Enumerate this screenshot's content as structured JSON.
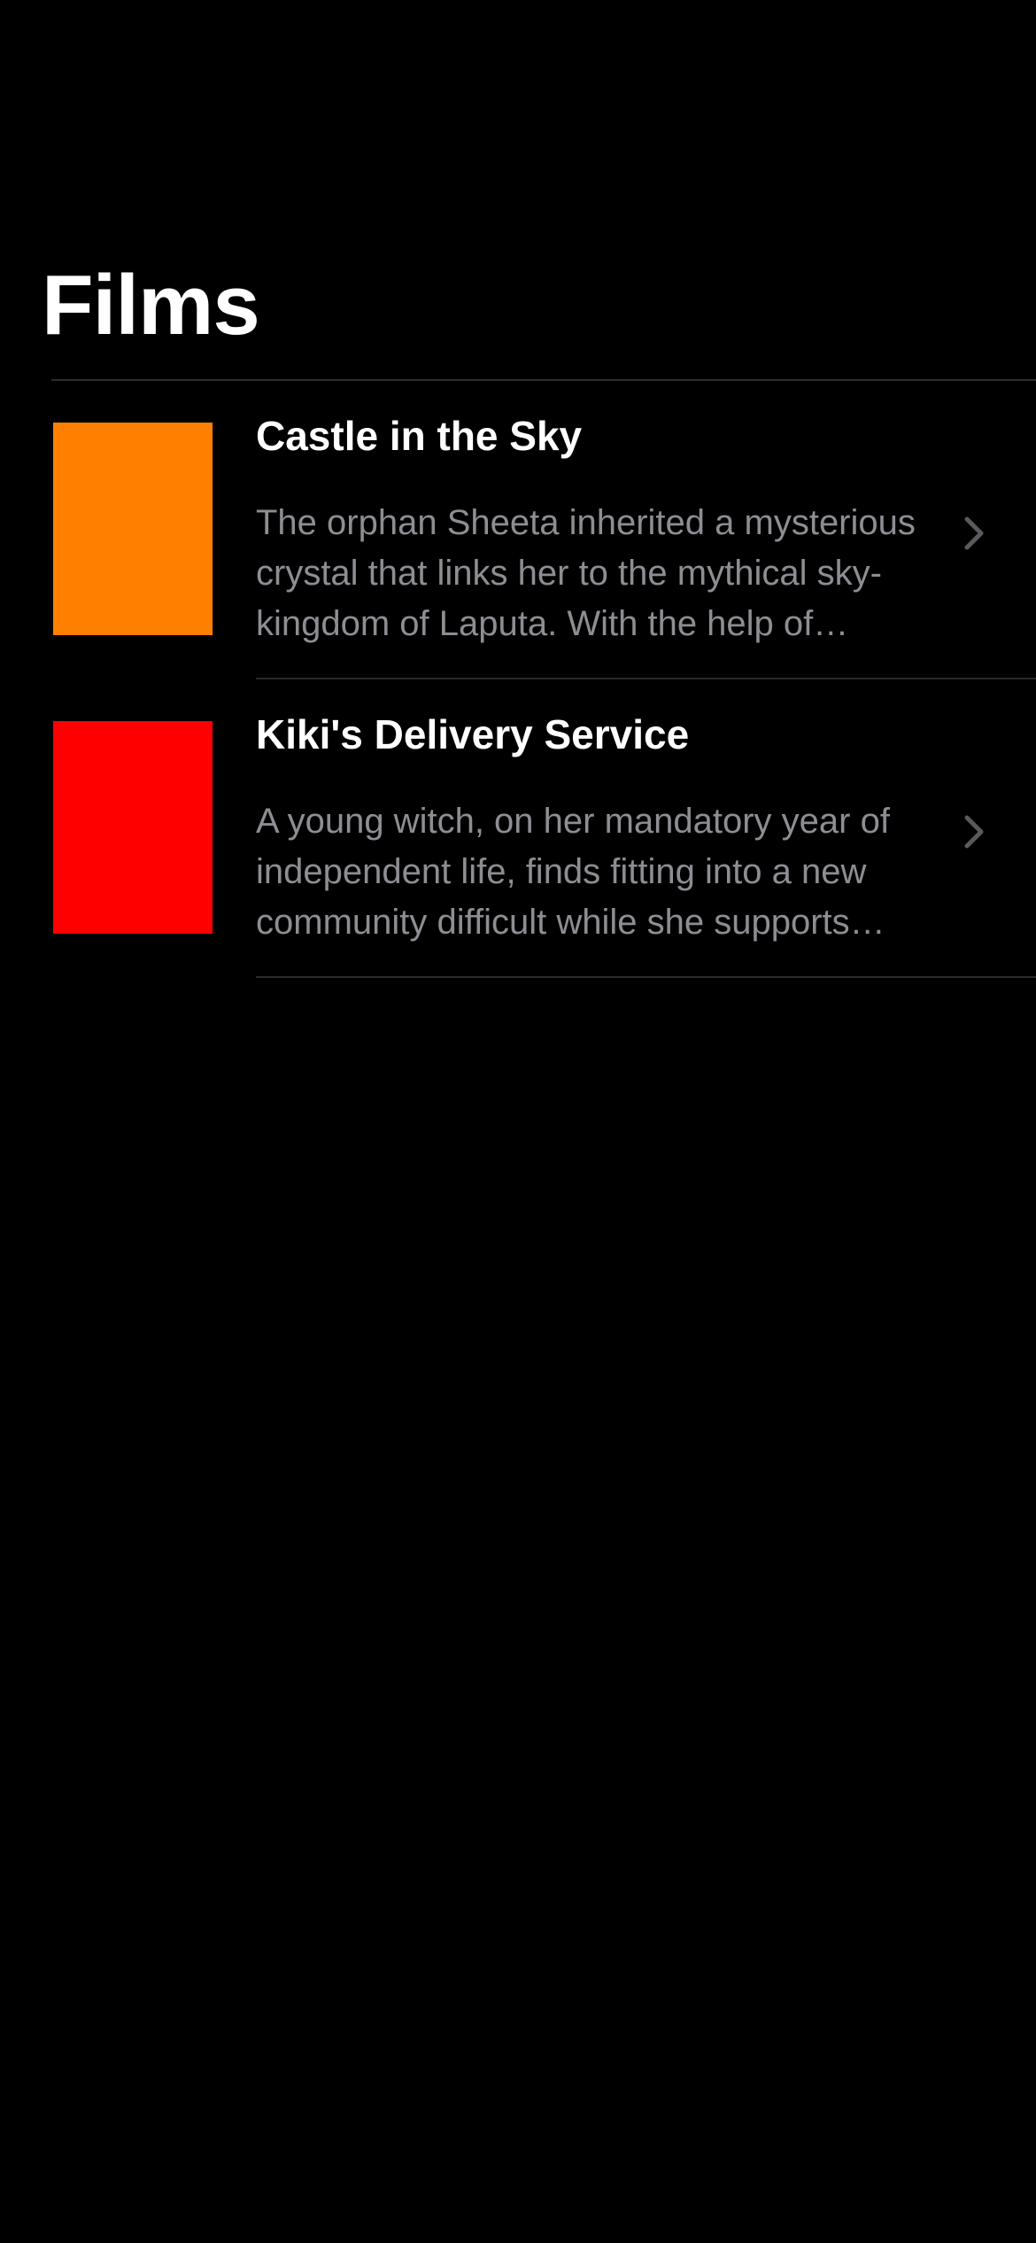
{
  "nav": {
    "title": "Films"
  },
  "films": [
    {
      "title": "Castle in the Sky",
      "description": "The orphan Sheeta inherited a mysterious crystal that links her to the mythical sky-kingdom of Laputa. With the help of resourceful Pazu and a rollicking band of sky pirates, she makes her way to the ruins of the once-great civilization.",
      "poster_color": "#ff8000"
    },
    {
      "title": "Kiki's Delivery Service",
      "description": "A young witch, on her mandatory year of independent life, finds fitting into a new community difficult while she supports herself by running an air courier service.",
      "poster_color": "#ff0000"
    }
  ],
  "colors": {
    "background": "#000000",
    "title_text": "#ffffff",
    "secondary_text": "#8d8d93",
    "separator": "#2b2b2d",
    "chevron": "#5a5a5e"
  },
  "icons": {
    "row_accessory": "chevron-right-icon"
  }
}
